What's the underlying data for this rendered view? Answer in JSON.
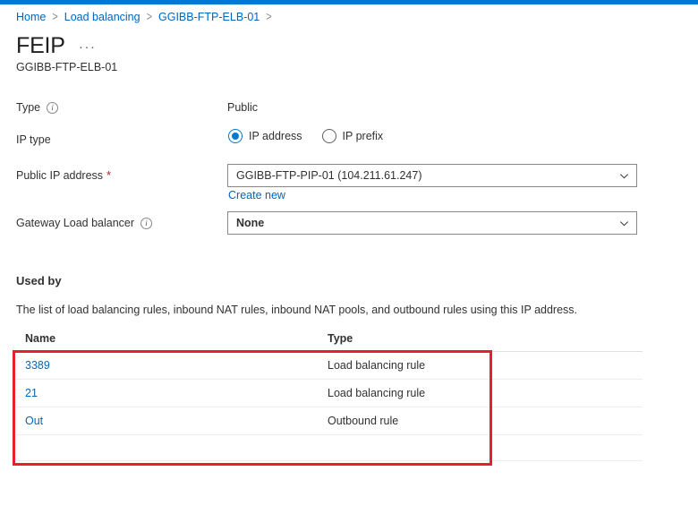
{
  "theme": {
    "accent": "#0078d4",
    "link": "#0066bd",
    "required_star": "#a4262c",
    "highlight_box": "#e8202a",
    "text": "#323130"
  },
  "breadcrumb": {
    "items": [
      {
        "label": "Home"
      },
      {
        "label": "Load balancing"
      },
      {
        "label": "GGIBB-FTP-ELB-01"
      }
    ],
    "separator": ">"
  },
  "header": {
    "title": "FEIP",
    "more_menu": "···",
    "subtitle": "GGIBB-FTP-ELB-01"
  },
  "form": {
    "type": {
      "label": "Type",
      "info_icon": "info-icon",
      "value": "Public"
    },
    "ip_type": {
      "label": "IP type",
      "options": [
        {
          "label": "IP address",
          "selected": true
        },
        {
          "label": "IP prefix",
          "selected": false
        }
      ]
    },
    "public_ip_address": {
      "label": "Public IP address",
      "required_marker": "*",
      "value": "GGIBB-FTP-PIP-01 (104.211.61.247)",
      "create_new_link": "Create new",
      "chevron_icon": "chevron-down-icon"
    },
    "gateway_load_balancer": {
      "label": "Gateway Load balancer",
      "info_icon": "info-icon",
      "value": "None",
      "chevron_icon": "chevron-down-icon"
    }
  },
  "used_by": {
    "heading": "Used by",
    "description": "The list of load balancing rules, inbound NAT rules, inbound NAT pools, and outbound rules using this IP address.",
    "columns": [
      "Name",
      "Type"
    ],
    "rows": [
      {
        "name": "3389",
        "type": "Load balancing rule"
      },
      {
        "name": "21",
        "type": "Load balancing rule"
      },
      {
        "name": "Out",
        "type": "Outbound rule"
      }
    ]
  }
}
